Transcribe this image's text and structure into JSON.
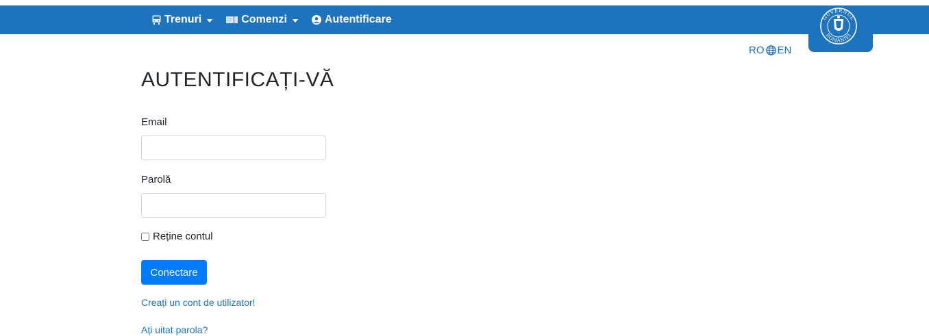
{
  "nav": {
    "items": [
      {
        "label": "Trenuri",
        "icon": "train-icon"
      },
      {
        "label": "Comenzi",
        "icon": "ticket-icon"
      },
      {
        "label": "Autentificare",
        "icon": "user-circle-icon"
      }
    ]
  },
  "lang": {
    "ro": "RO",
    "en": "EN"
  },
  "emblem": {
    "text_top": "GUVERNUL",
    "text_bottom": "ROMÂNIEI"
  },
  "form": {
    "title": "AUTENTIFICAȚI-VĂ",
    "email_label": "Email",
    "email_value": "",
    "password_label": "Parolă",
    "password_value": "",
    "remember_label": "Reține contul",
    "remember_checked": false,
    "submit_label": "Conectare",
    "register_link": "Creați un cont de utilizator!",
    "forgot_link": "Ați uitat parola?"
  },
  "colors": {
    "brand": "#1e73be",
    "button": "#007bff"
  }
}
